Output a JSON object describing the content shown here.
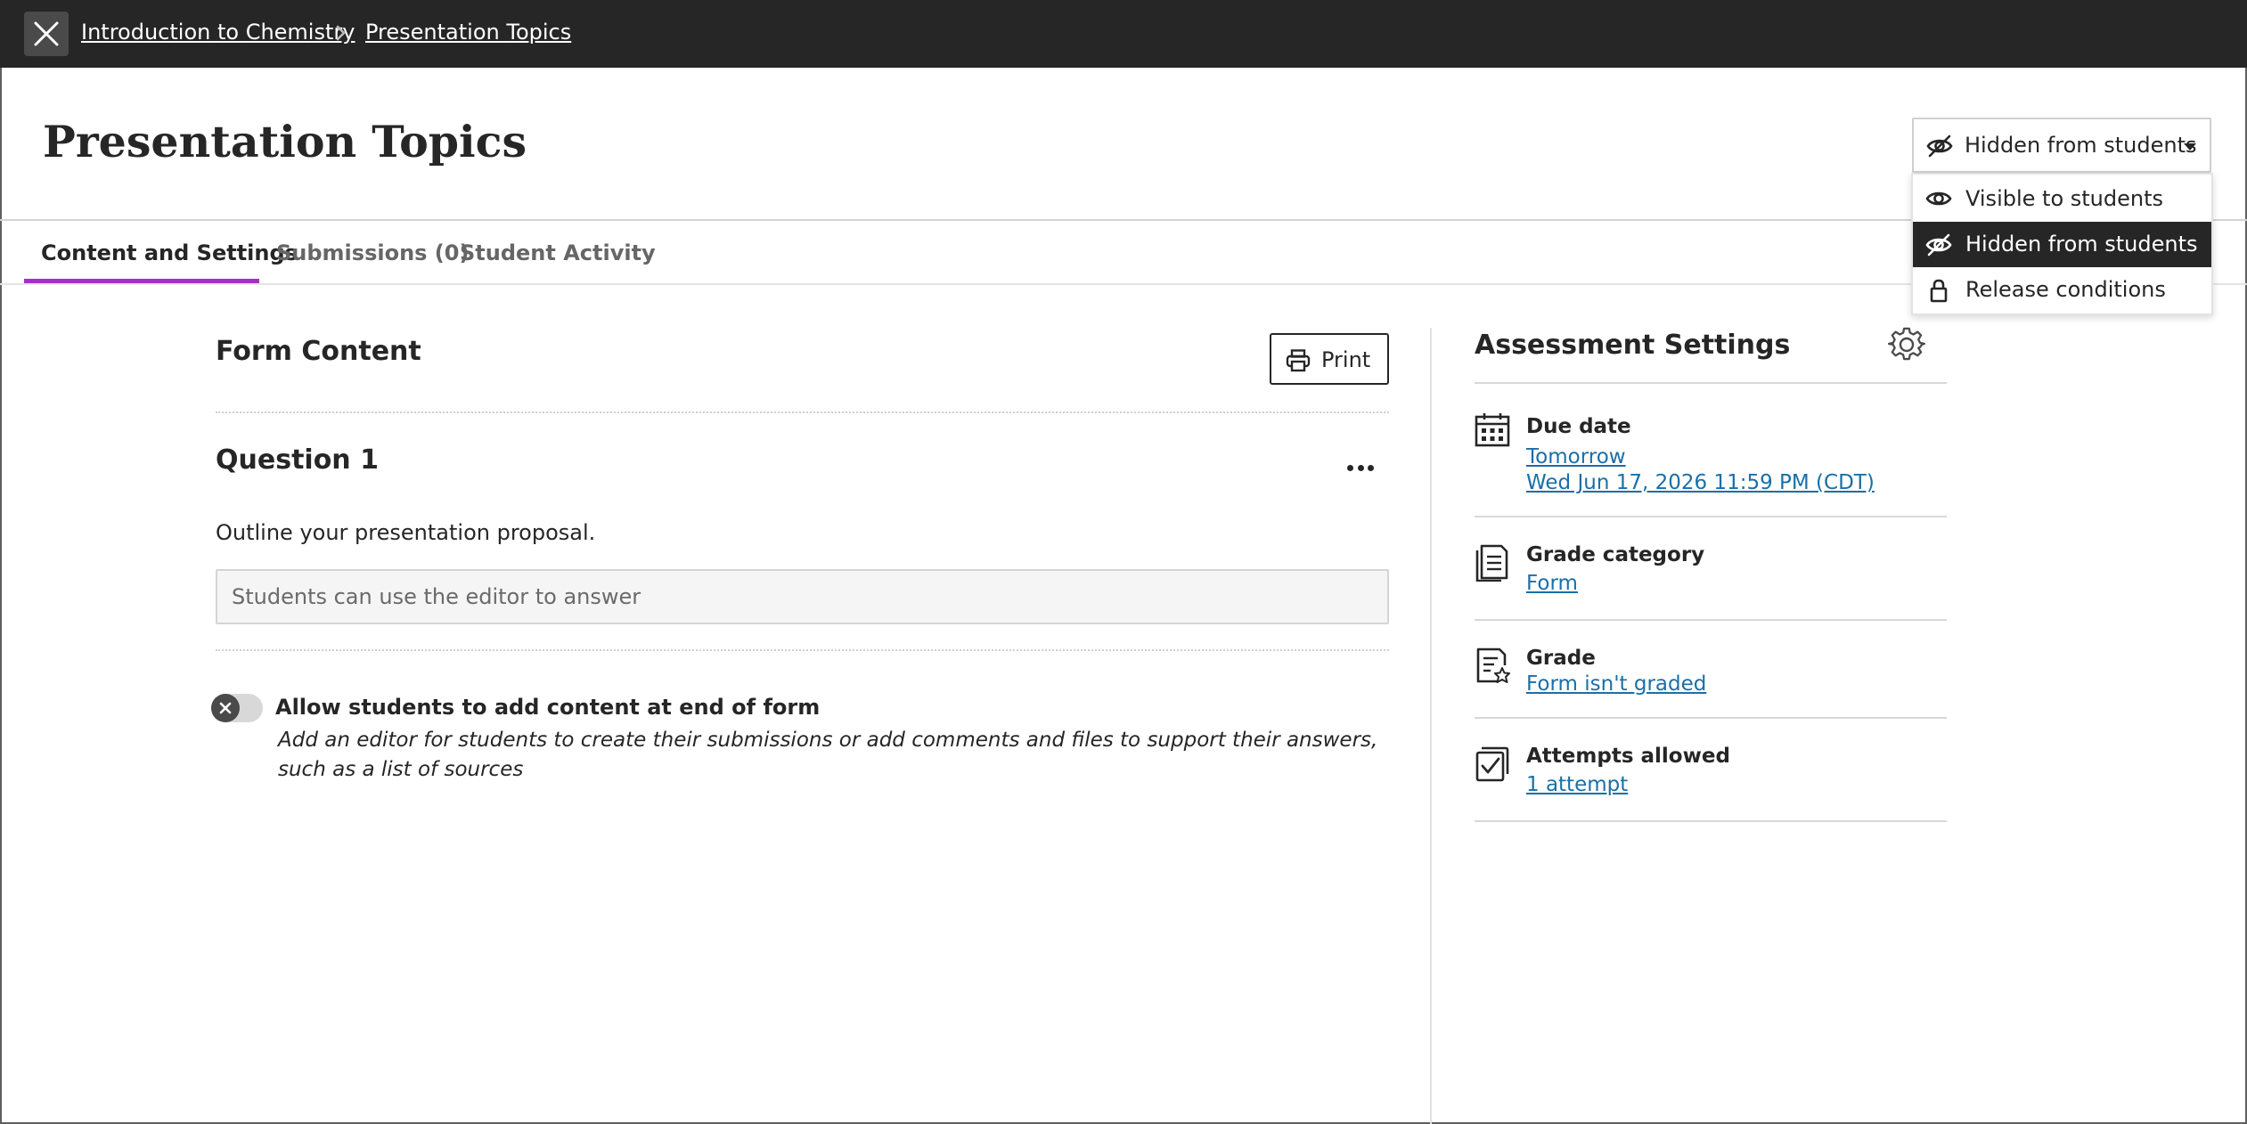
{
  "breadcrumb": {
    "course": "Introduction to Chemistry",
    "page": "Presentation Topics"
  },
  "header": {
    "title": "Presentation Topics",
    "visibility_label": "Hidden from students"
  },
  "visibility_menu": {
    "items": [
      {
        "label": "Visible to students",
        "icon": "eye-icon",
        "selected": false
      },
      {
        "label": "Hidden from students",
        "icon": "eye-slash-icon",
        "selected": true
      },
      {
        "label": "Release conditions",
        "icon": "lock-icon",
        "selected": false
      }
    ]
  },
  "tabs": [
    {
      "label": "Content and Settings",
      "active": true
    },
    {
      "label": "Submissions (0)",
      "active": false
    },
    {
      "label": "Student Activity",
      "active": false
    }
  ],
  "form": {
    "heading": "Form Content",
    "print_label": "Print",
    "question": {
      "title": "Question 1",
      "text": "Outline your presentation proposal.",
      "answer_placeholder": "Students can use the editor to answer"
    },
    "toggle": {
      "label": "Allow students to add content at end of form",
      "description": "Add an editor for students to create their submissions or add comments and files to support their answers, such as a list of sources",
      "on": false
    }
  },
  "assessment": {
    "heading": "Assessment Settings",
    "due_date": {
      "title": "Due date",
      "relative": "Tomorrow",
      "value": "Wed Jun 17, 2026 11:59 PM (CDT)"
    },
    "grade_category": {
      "title": "Grade category",
      "value": "Form"
    },
    "grade": {
      "title": "Grade",
      "value": "Form isn't graded"
    },
    "attempts": {
      "title": "Attempts allowed",
      "value": "1 attempt"
    }
  },
  "colors": {
    "topbar": "#262626",
    "accent_tab": "#a133c4",
    "link": "#1a6fa8",
    "menu_selected": "#262626"
  }
}
